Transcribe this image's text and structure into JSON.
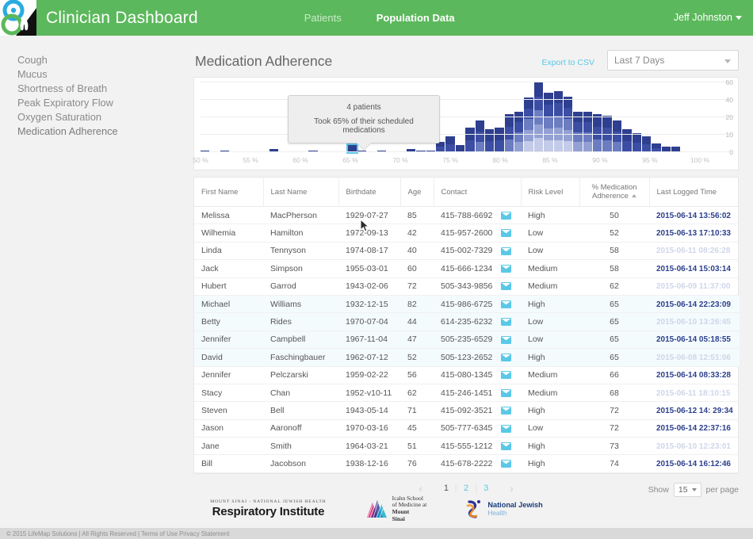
{
  "header": {
    "brand_title": "Clinician Dashboard",
    "logo_icon": "lungs-circles-logo",
    "nav": [
      {
        "label": "Patients",
        "active": false
      },
      {
        "label": "Population Data",
        "active": true
      }
    ],
    "user_name": "Jeff Johnston",
    "user_caret_icon": "caret-down-icon",
    "bar_color": "#5cb85c"
  },
  "sidebar": {
    "items": [
      {
        "label": "Cough"
      },
      {
        "label": "Mucus"
      },
      {
        "label": "Shortness of Breath"
      },
      {
        "label": "Peak Expiratory Flow"
      },
      {
        "label": "Oxygen Saturation"
      },
      {
        "label": "Medication Adherence"
      }
    ]
  },
  "main": {
    "page_title": "Medication Adherence",
    "export_label": "Export to CSV",
    "range_value": "Last 7 Days",
    "range_caret_icon": "caret-down-icon",
    "accent_color": "#5bc8e8"
  },
  "chart_data": {
    "type": "bar",
    "title": "Medication Adherence",
    "xlabel": "",
    "ylabel": "",
    "x_tick_labels": [
      "50 %",
      "55 %",
      "60 %",
      "65 %",
      "70 %",
      "75 %",
      "80 %",
      "85 %",
      "90 %",
      "95 %",
      "100 %"
    ],
    "y_tick_labels": [
      "60",
      "40",
      "20",
      "10",
      "0"
    ],
    "ylim": [
      0,
      60
    ],
    "grid": true,
    "legend": "none",
    "stacked": true,
    "segment_colors": [
      "#c3cbe8",
      "#93a0d3",
      "#6b7cc0",
      "#3b4ea4",
      "#2e3f8f"
    ],
    "categories": [
      50,
      51,
      52,
      53,
      54,
      55,
      56,
      57,
      58,
      59,
      60,
      61,
      62,
      63,
      64,
      65,
      66,
      67,
      68,
      69,
      70,
      71,
      72,
      73,
      74,
      75,
      76,
      77,
      78,
      79,
      80,
      81,
      82,
      83,
      84,
      85,
      86,
      87,
      88,
      89,
      90,
      91,
      92,
      93,
      94,
      95,
      96,
      97,
      98,
      99,
      100
    ],
    "values": [
      1,
      0,
      1,
      0,
      0,
      0,
      0,
      2,
      0,
      0,
      0,
      1,
      0,
      0,
      0,
      4,
      1,
      0,
      1,
      0,
      0,
      2,
      1,
      1,
      6,
      9,
      4,
      14,
      18,
      13,
      14,
      24,
      26,
      43,
      60,
      48,
      50,
      44,
      26,
      26,
      24,
      22,
      18,
      13,
      11,
      9,
      5,
      3,
      3,
      0,
      0
    ],
    "annotation": {
      "line1": "4 patients",
      "line2": "Took 65% of their scheduled medications",
      "at_category": 65,
      "value": 4
    }
  },
  "table": {
    "columns": [
      {
        "label": "First Name",
        "sorted": false
      },
      {
        "label": "Last Name",
        "sorted": false
      },
      {
        "label": "Birthdate",
        "sorted": false
      },
      {
        "label": "Age",
        "sorted": false
      },
      {
        "label": "Contact",
        "sorted": false
      },
      {
        "label": "Risk Level",
        "sorted": false
      },
      {
        "label": "% Medication Adherence",
        "sorted": true
      },
      {
        "label": "Last Logged Time",
        "sorted": false
      }
    ],
    "rows": [
      {
        "first": "Melissa",
        "last": "MacPherson",
        "birth": "1929-07-27",
        "age": "85",
        "phone": "415-788-6692",
        "risk": "High",
        "adherence": "50",
        "logged": "2015-06-14 13:56:02",
        "faded": false
      },
      {
        "first": "Wilhemia",
        "last": "Hamilton",
        "birth": "1972-09-13",
        "age": "42",
        "phone": "415-957-2600",
        "risk": "Low",
        "adherence": "52",
        "logged": "2015-06-13 17:10:33",
        "faded": false
      },
      {
        "first": "Linda",
        "last": "Tennyson",
        "birth": "1974-08-17",
        "age": "40",
        "phone": "415-002-7329",
        "risk": "Low",
        "adherence": "58",
        "logged": "2015-06-11 08:26:28",
        "faded": true
      },
      {
        "first": "Jack",
        "last": "Simpson",
        "birth": "1955-03-01",
        "age": "60",
        "phone": "415-666-1234",
        "risk": "Medium",
        "adherence": "58",
        "logged": "2015-06-14 15:03:14",
        "faded": false
      },
      {
        "first": "Hubert",
        "last": "Garrod",
        "birth": "1943-02-06",
        "age": "72",
        "phone": "505-343-9856",
        "risk": "Medium",
        "adherence": "62",
        "logged": "2015-06-09 11:37:00",
        "faded": true
      },
      {
        "first": "Michael",
        "last": "Williams",
        "birth": "1932-12-15",
        "age": "82",
        "phone": "415-986-6725",
        "risk": "High",
        "adherence": "65",
        "logged": "2015-06-14 22:23:09",
        "faded": false
      },
      {
        "first": "Betty",
        "last": "Rides",
        "birth": "1970-07-04",
        "age": "44",
        "phone": "614-235-6232",
        "risk": "Low",
        "adherence": "65",
        "logged": "2015-06-10 13:26:45",
        "faded": true
      },
      {
        "first": "Jennifer",
        "last": "Campbell",
        "birth": "1967-11-04",
        "age": "47",
        "phone": "505-235-6529",
        "risk": "Low",
        "adherence": "65",
        "logged": "2015-06-14 05:18:55",
        "faded": false
      },
      {
        "first": "David",
        "last": "Faschingbauer",
        "birth": "1962-07-12",
        "age": "52",
        "phone": "505-123-2652",
        "risk": "High",
        "adherence": "65",
        "logged": "2015-06-08 12:51:06",
        "faded": true
      },
      {
        "first": "Jennifer",
        "last": "Pelczarski",
        "birth": "1959-02-22",
        "age": "56",
        "phone": "415-080-1345",
        "risk": "Medium",
        "adherence": "66",
        "logged": "2015-06-14 08:33:28",
        "faded": false
      },
      {
        "first": "Stacy",
        "last": "Chan",
        "birth": "1952-v10-11",
        "age": "62",
        "phone": "415-246-1451",
        "risk": "Medium",
        "adherence": "68",
        "logged": "2015-06-11 18:10:15",
        "faded": true
      },
      {
        "first": "Steven",
        "last": "Bell",
        "birth": "1943-05-14",
        "age": "71",
        "phone": "415-092-3521",
        "risk": "High",
        "adherence": "72",
        "logged": "2015-06-12 14: 29:34",
        "faded": false
      },
      {
        "first": "Jason",
        "last": "Aaronoff",
        "birth": "1970-03-16",
        "age": "45",
        "phone": "505-777-6345",
        "risk": "Low",
        "adherence": "72",
        "logged": "2015-06-14 22:37:16",
        "faded": false
      },
      {
        "first": "Jane",
        "last": "Smith",
        "birth": "1964-03-21",
        "age": "51",
        "phone": "415-555-1212",
        "risk": "High",
        "adherence": "73",
        "logged": "2015-06-10 12:23:01",
        "faded": true
      },
      {
        "first": "Bill",
        "last": "Jacobson",
        "birth": "1938-12-16",
        "age": "76",
        "phone": "415-678-2222",
        "risk": "High",
        "adherence": "74",
        "logged": "2015-06-14 16:12:46",
        "faded": false
      }
    ],
    "mail_icon": "envelope-icon"
  },
  "pagination": {
    "prev_icon": "chevron-left-icon",
    "next_icon": "chevron-right-icon",
    "pages": [
      {
        "label": "1",
        "current": true
      },
      {
        "label": "2",
        "current": false
      },
      {
        "label": "3",
        "current": false
      }
    ],
    "show_label": "Show",
    "per_page_value": "15",
    "per_page_caret_icon": "caret-down-icon",
    "per_page_label": "per page"
  },
  "footer": {
    "respiratory_institute": {
      "top_line": "MOUNT SINAI - NATIONAL JEWISH HEALTH",
      "main_line": "Respiratory Institute"
    },
    "icahn": {
      "icon": "icahn-mountain-logo",
      "line1": "Icahn School",
      "line2": "of Medicine at",
      "line3": "Mount",
      "line4": "Sinai"
    },
    "njh": {
      "icon": "njh-swirl-logo",
      "line1": "National Jewish",
      "line2": "Health"
    },
    "copyright": "© 2015 LifeMap Solutions | All Rights Reserved | Terms of Use Privacy Statement"
  }
}
